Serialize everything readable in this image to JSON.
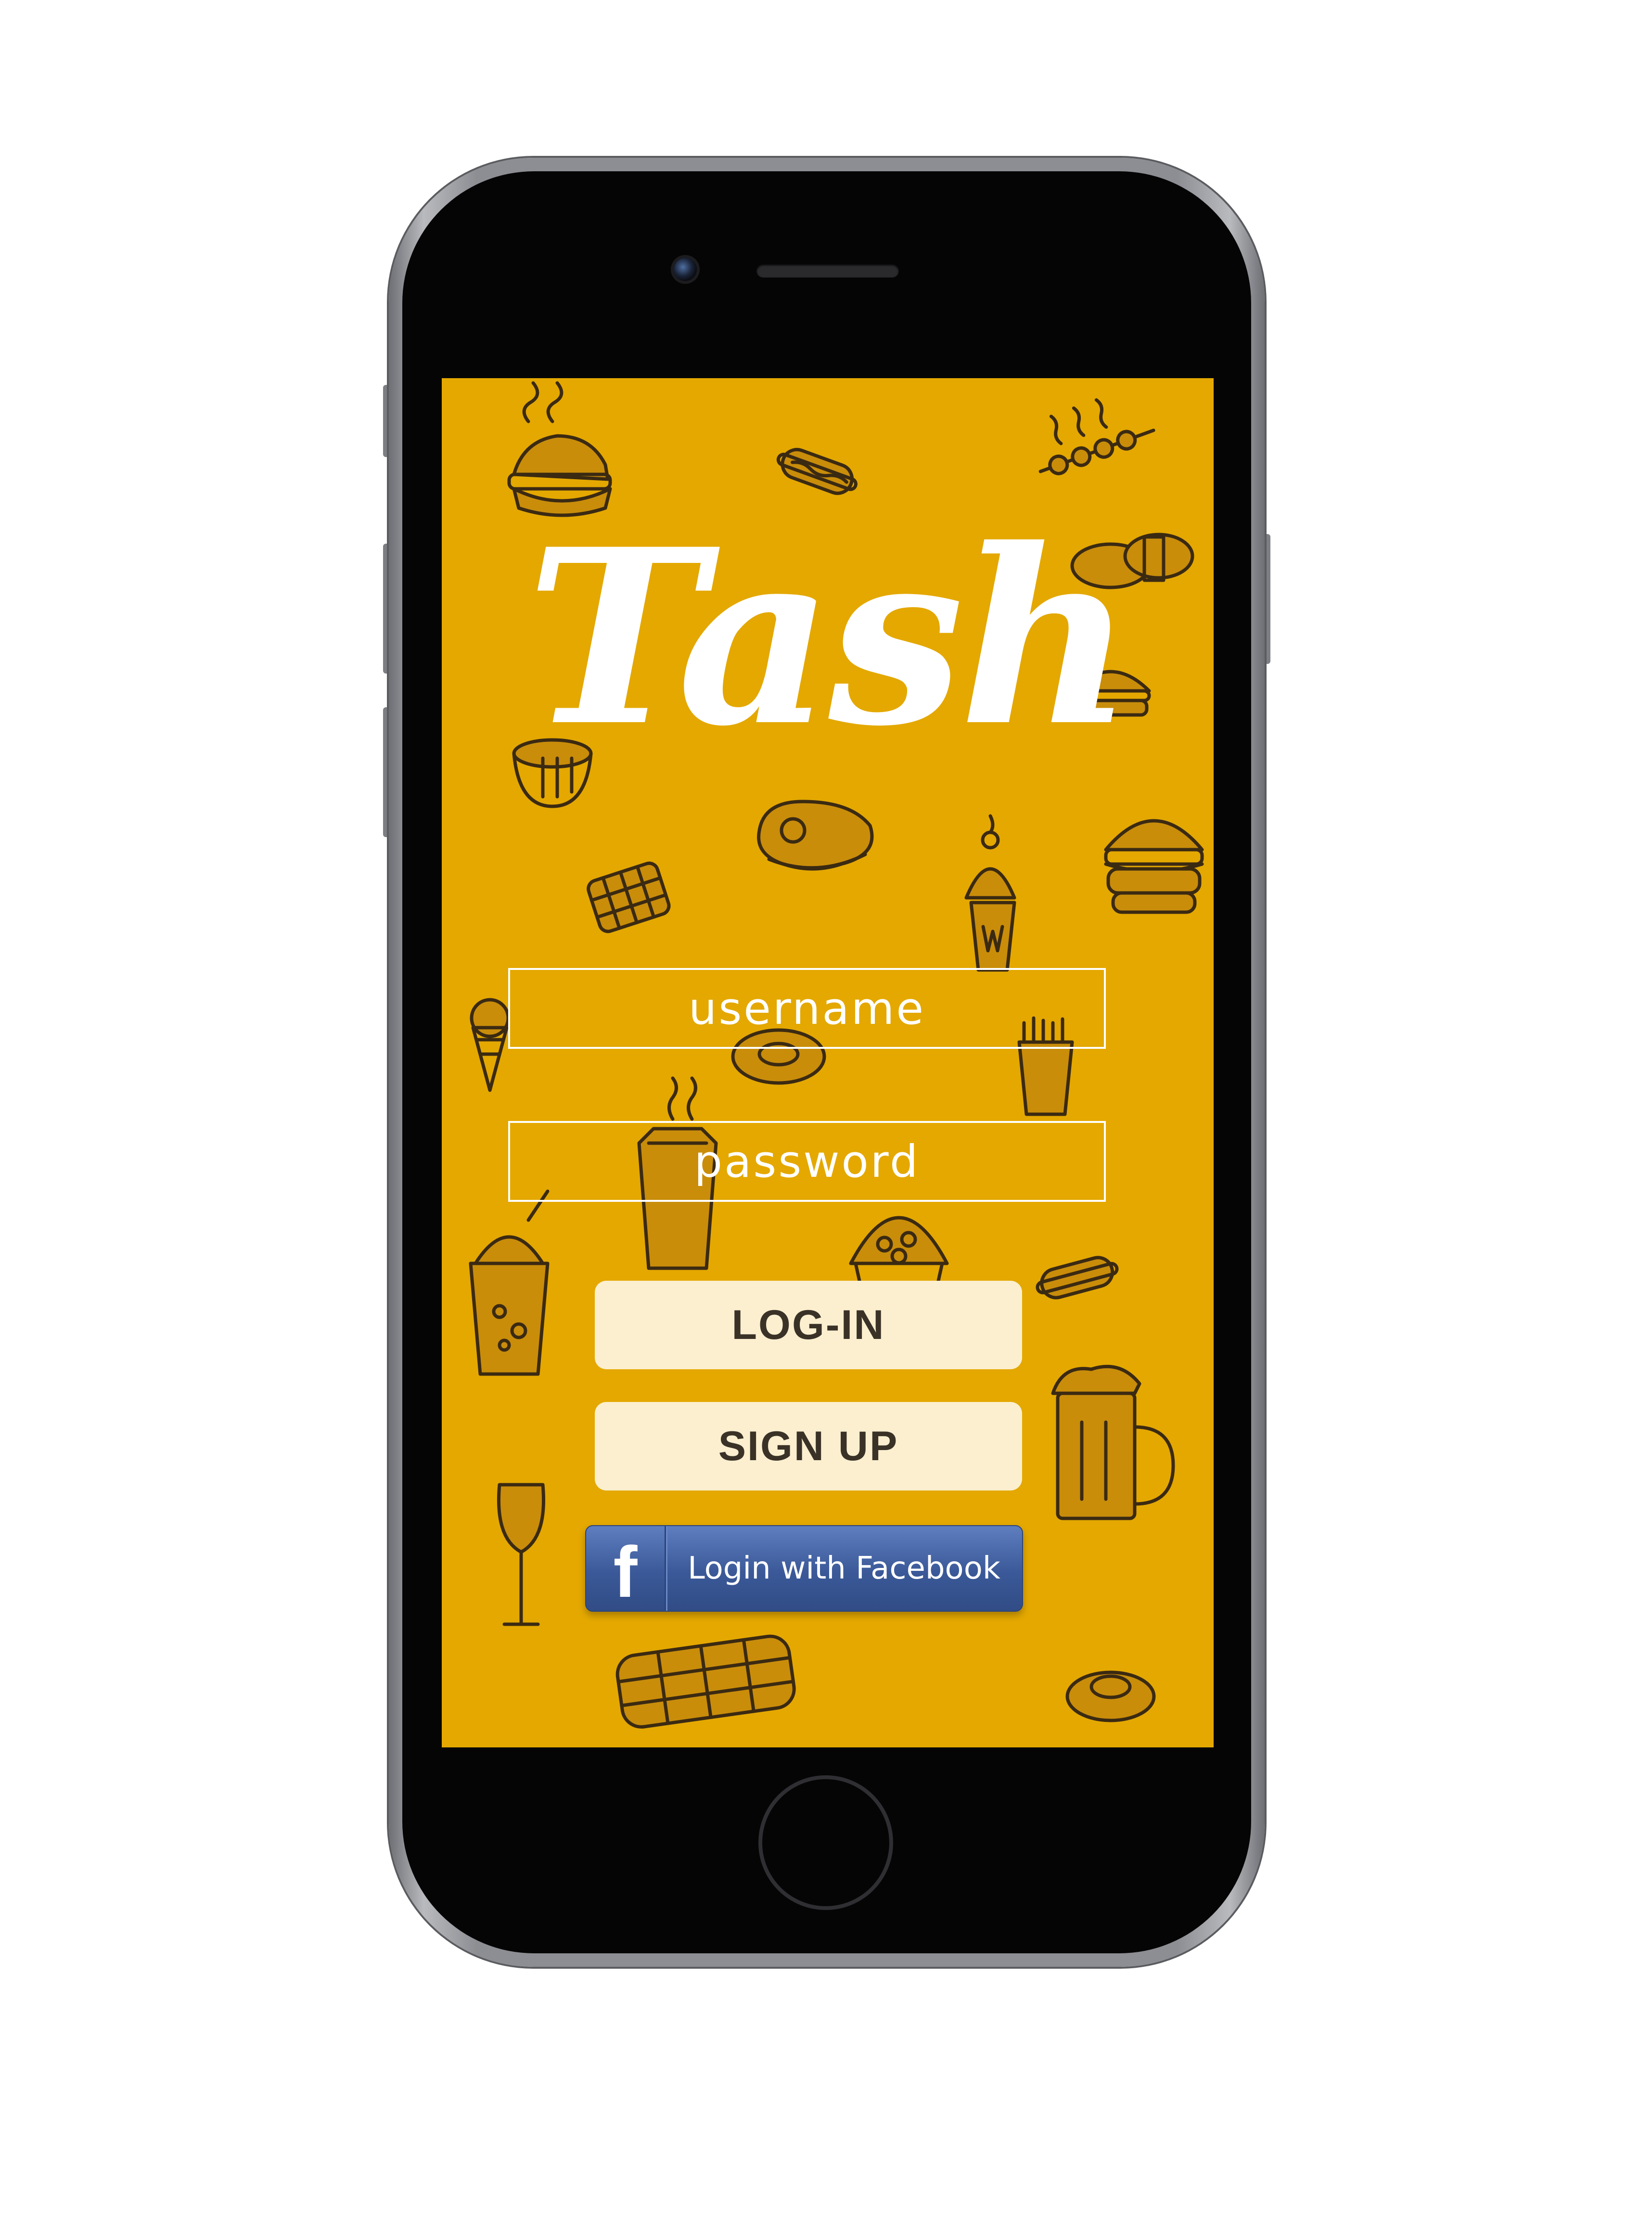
{
  "app": {
    "logo_text": "Tash"
  },
  "login_form": {
    "username_placeholder": "username",
    "password_placeholder": "password",
    "login_label": "LOG-IN",
    "signup_label": "SIGN UP",
    "facebook_label": "Login with Facebook",
    "facebook_icon_glyph": "f"
  },
  "colors": {
    "screen_background": "#e4a800",
    "button_background": "#fbefcf",
    "button_text": "#3a3227",
    "facebook_blue": "#3b5998",
    "doodle_stroke": "#3b2a12"
  },
  "background_doodles": [
    "burger-icon",
    "hotdog-icon",
    "skewer-icon",
    "sushi-icon",
    "sandwich-icon",
    "cupcake-icon",
    "steak-icon",
    "waffle-icon",
    "sundae-icon",
    "ice-cream-cone-icon",
    "fries-icon",
    "smoothie-icon",
    "beer-mug-icon",
    "wine-glass-icon",
    "pancake-icon"
  ]
}
